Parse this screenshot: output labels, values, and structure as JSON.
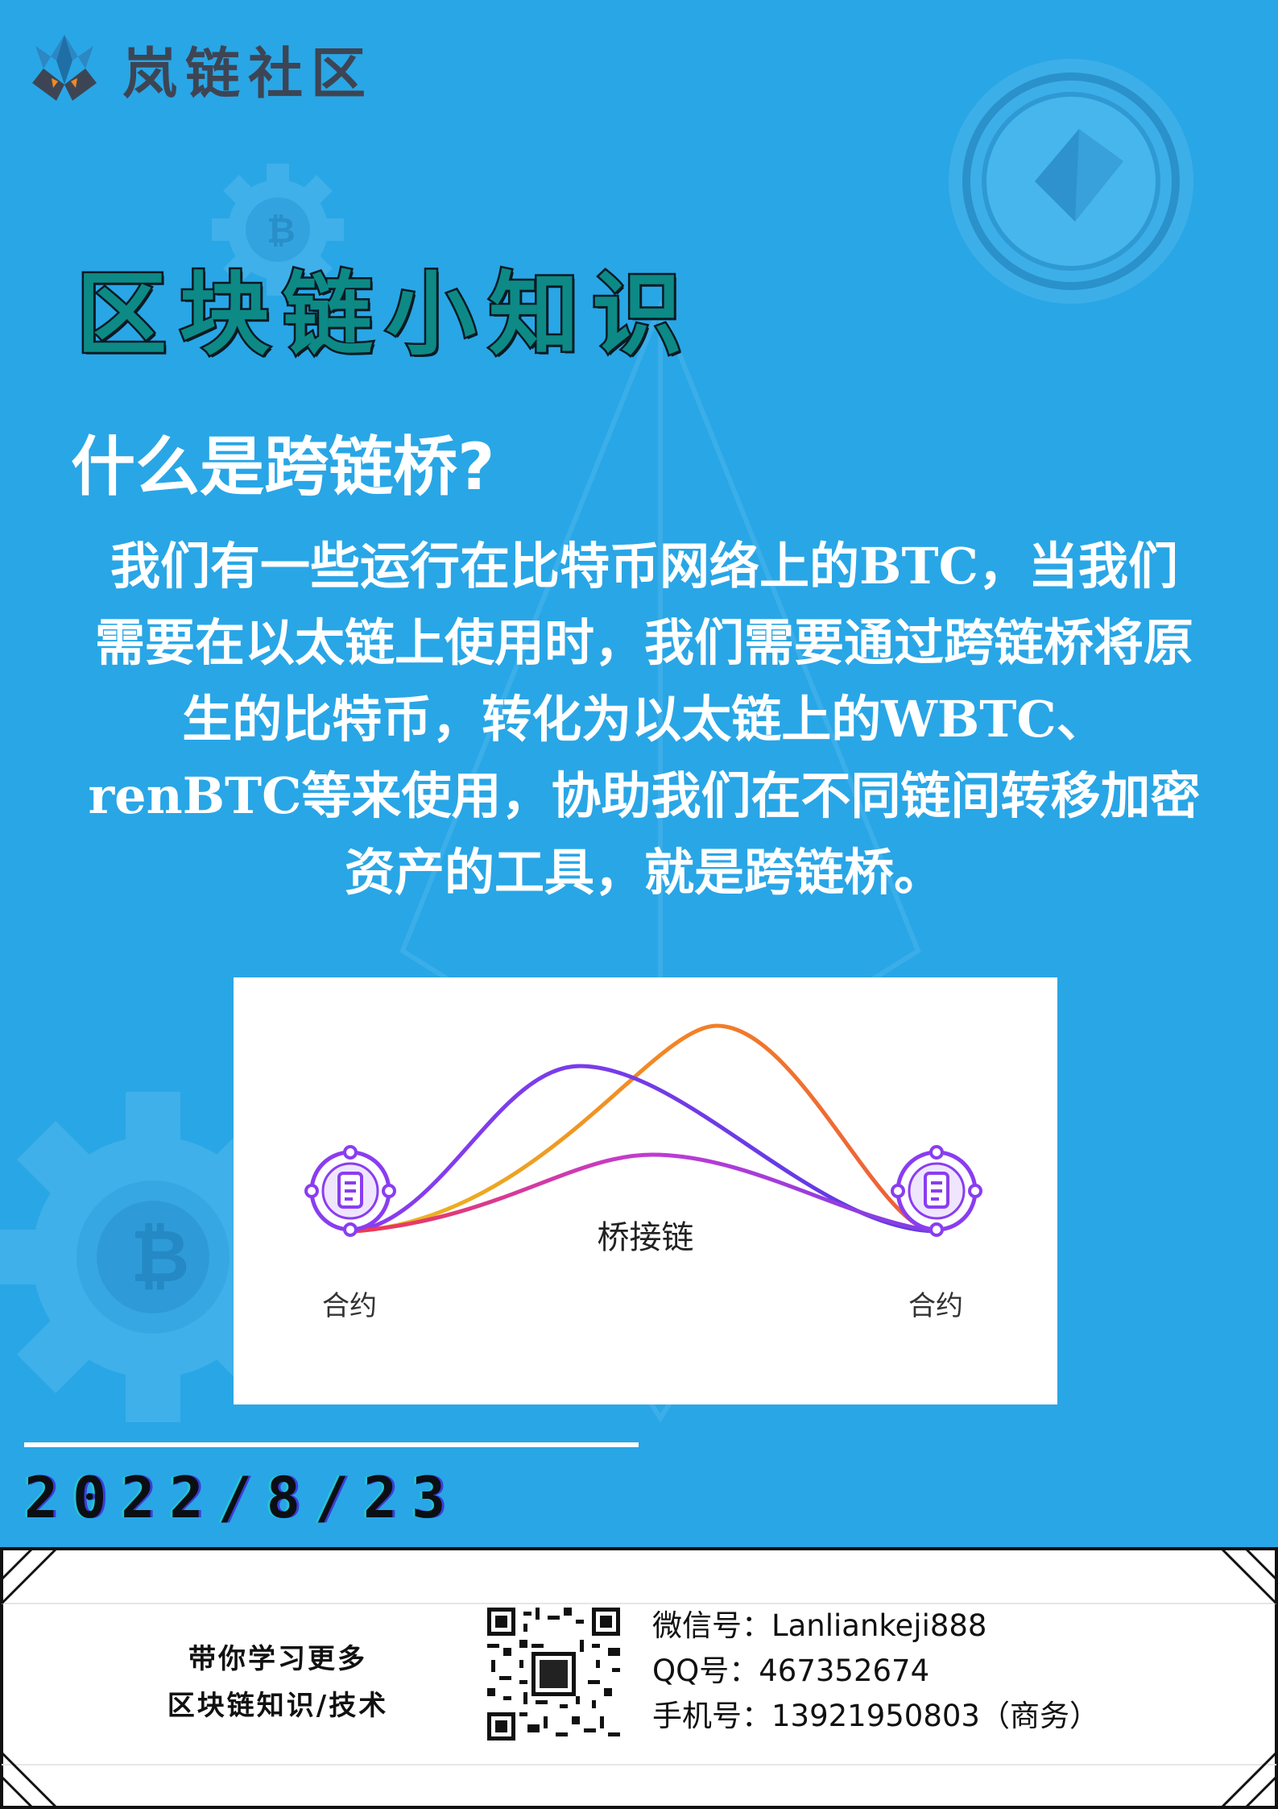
{
  "brand": {
    "name": "岚链社区",
    "logo_icon": "dragon-crest-logo"
  },
  "heading": "区块链小知识",
  "question": "什么是跨链桥?",
  "body_lines": [
    "我们有一些运行在比特币网络上的BTC，当我们",
    "需要在以太链上使用时，我们需要通过跨链桥将原",
    "生的比特币，转化为以太链上的WBTC、",
    "renBTC等来使用，协助我们在不同链间转移加密",
    "资产的工具，就是跨链桥。"
  ],
  "diagram": {
    "center_label": "桥接链",
    "left_label": "合约",
    "right_label": "合约",
    "node_icon": "contract-document-icon",
    "curve_colors": [
      "#7b3fe4",
      "#f08a24",
      "#c23bd1"
    ]
  },
  "date": "2022/8/23",
  "footer": {
    "slogan_lines": [
      "带你学习更多",
      "区块链知识/技术"
    ],
    "qr_icon": "qr-code",
    "contacts": [
      {
        "label": "微信号：",
        "value": "Lanliankeji888"
      },
      {
        "label": "QQ号：",
        "value": "467352674"
      },
      {
        "label": "手机号：",
        "value": "13921950803（商务）"
      }
    ]
  },
  "colors": {
    "background": "#29a6e6",
    "heading": "#0d8a86",
    "text": "#ffffff"
  }
}
